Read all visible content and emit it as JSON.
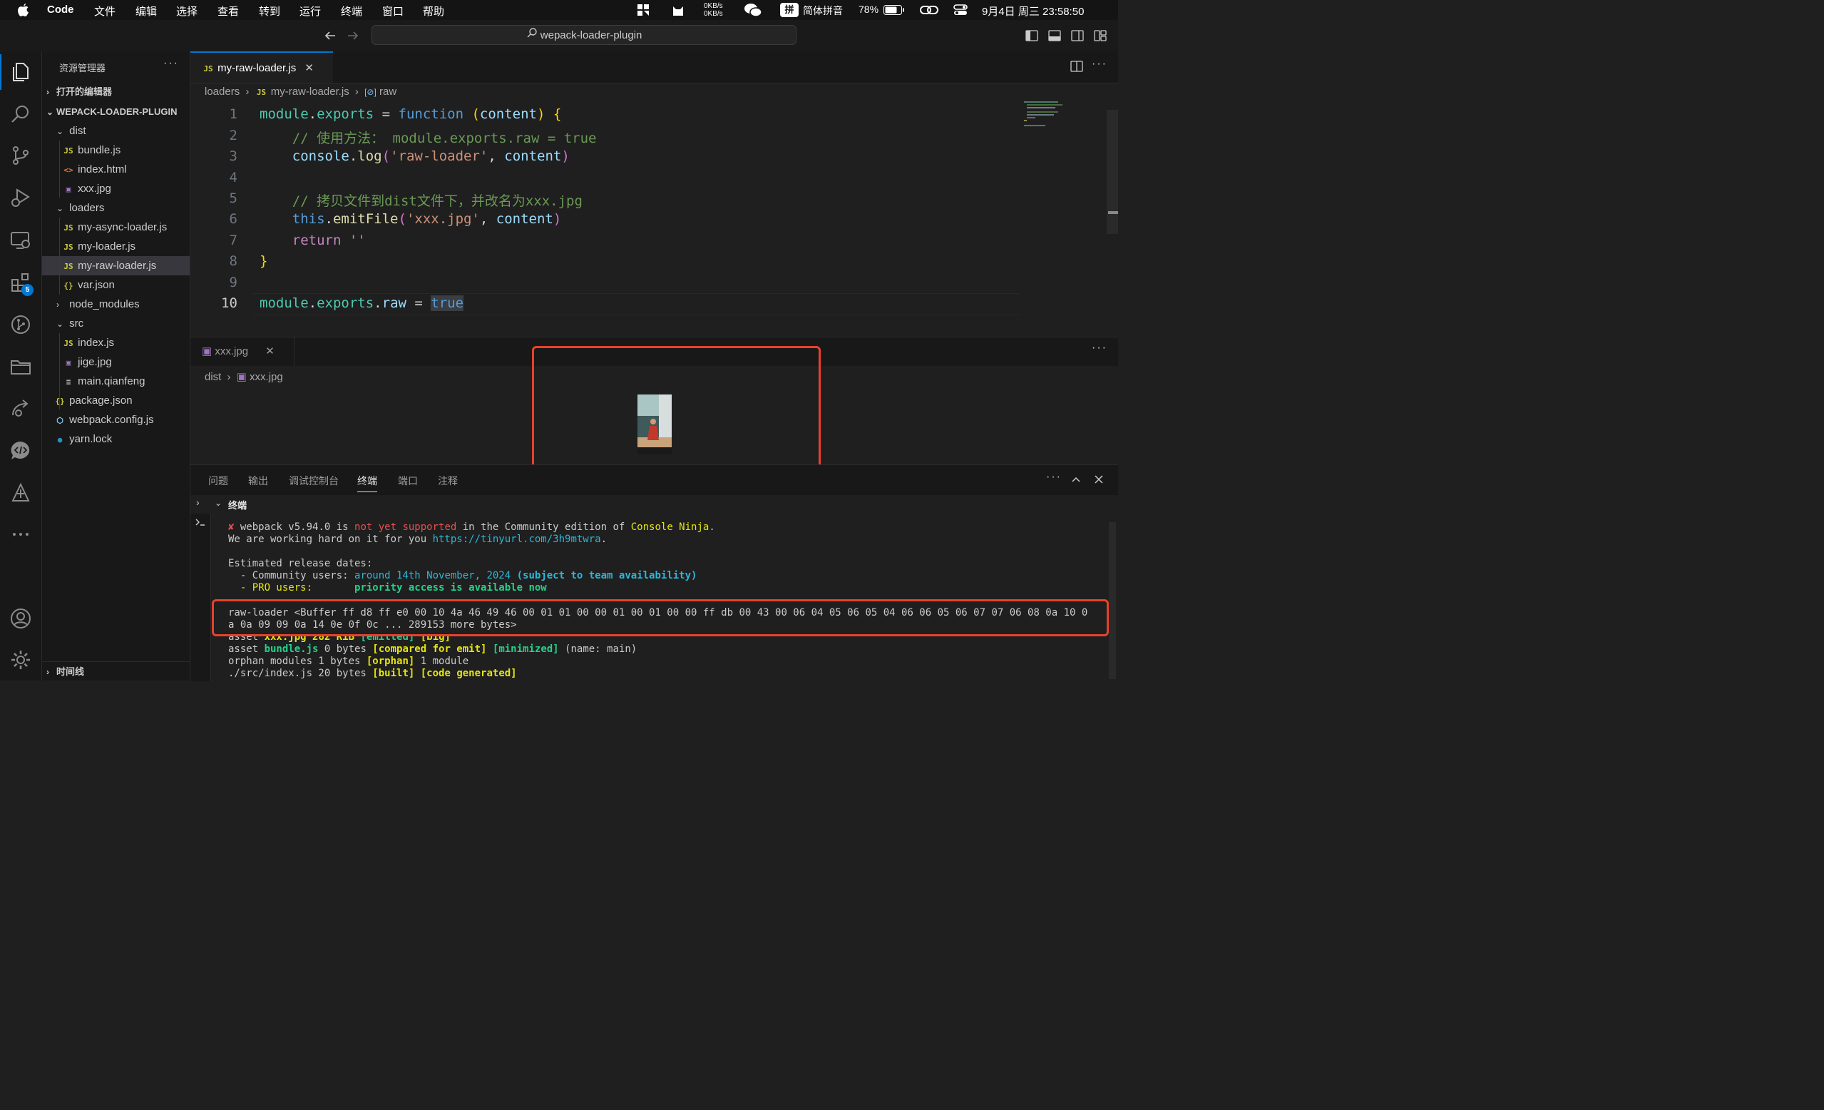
{
  "menubar": {
    "app": "Code",
    "items": [
      "文件",
      "编辑",
      "选择",
      "查看",
      "转到",
      "运行",
      "终端",
      "窗口",
      "帮助"
    ],
    "net_up": "0KB/s",
    "net_down": "0KB/s",
    "input_method": "简体拼音",
    "input_badge": "拼",
    "battery": "78%",
    "datetime": "9月4日 周三  23:58:50"
  },
  "titlebar": {
    "search": "wepack-loader-plugin"
  },
  "activity": {
    "extensions_badge": "5"
  },
  "sidebar": {
    "title": "资源管理器",
    "open_editors": "打开的编辑器",
    "project": "WEPACK-LOADER-PLUGIN",
    "timeline": "时间线",
    "tree": [
      {
        "label": "dist",
        "icon": "folder-open"
      },
      {
        "label": "bundle.js",
        "icon": "js"
      },
      {
        "label": "index.html",
        "icon": "html"
      },
      {
        "label": "xxx.jpg",
        "icon": "image"
      },
      {
        "label": "loaders",
        "icon": "folder-open"
      },
      {
        "label": "my-async-loader.js",
        "icon": "js"
      },
      {
        "label": "my-loader.js",
        "icon": "js"
      },
      {
        "label": "my-raw-loader.js",
        "icon": "js"
      },
      {
        "label": "var.json",
        "icon": "json"
      },
      {
        "label": "node_modules",
        "icon": "folder-closed"
      },
      {
        "label": "src",
        "icon": "folder-open"
      },
      {
        "label": "index.js",
        "icon": "js"
      },
      {
        "label": "jige.jpg",
        "icon": "image"
      },
      {
        "label": "main.qianfeng",
        "icon": "text"
      },
      {
        "label": "package.json",
        "icon": "json"
      },
      {
        "label": "webpack.config.js",
        "icon": "webpack"
      },
      {
        "label": "yarn.lock",
        "icon": "yarn"
      }
    ]
  },
  "editor": {
    "tab": "my-raw-loader.js",
    "breadcrumb": [
      "loaders",
      "my-raw-loader.js",
      "raw"
    ],
    "line_numbers": [
      "1",
      "2",
      "3",
      "4",
      "5",
      "6",
      "7",
      "8",
      "9",
      "10"
    ]
  },
  "preview": {
    "tab": "xxx.jpg",
    "breadcrumb": [
      "dist",
      "xxx.jpg"
    ]
  },
  "panel": {
    "tabs": [
      "问题",
      "输出",
      "调试控制台",
      "终端",
      "端口",
      "注释"
    ],
    "active_tab": "终端",
    "terminal_header": "终端"
  }
}
